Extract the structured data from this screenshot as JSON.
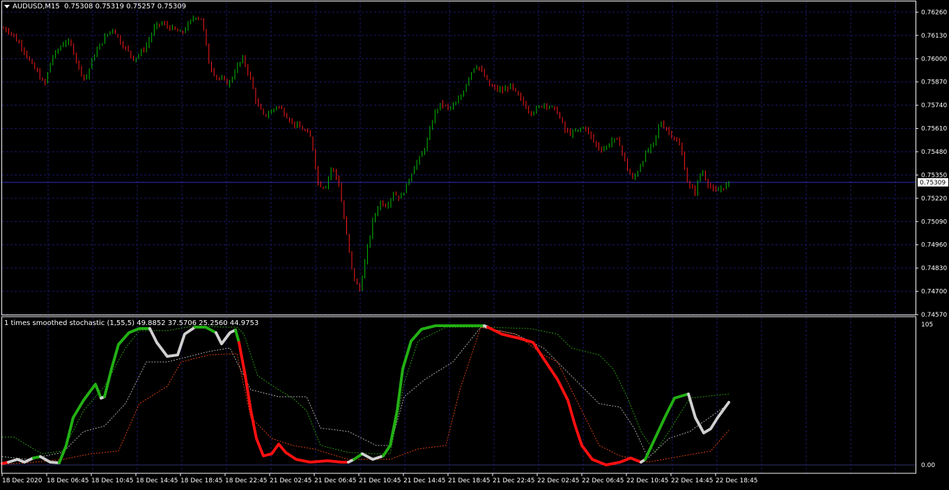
{
  "price_header": {
    "symbol": "AUDUSD,M15",
    "ohlc": "0.75308 0.75319 0.75257 0.75309"
  },
  "osc_header": {
    "text": "1 times smoothed stochastic (1,55,5) 49.8852 37.5706 25.2560 44.9753"
  },
  "colors": {
    "background": "#000000",
    "grid": "#1a1a6e",
    "bull_candle": "#00c000",
    "bear_candle": "#ff1a1a",
    "osc_up": "#22b014",
    "osc_down": "#ff1010",
    "osc_neutral": "#d0d0d0",
    "band_upper": "#2a9a10",
    "band_mid": "#b0b0b0",
    "band_lower": "#e04010",
    "current_price_line": "#3030c0"
  },
  "chart_data": [
    {
      "type": "candlestick",
      "title": "AUDUSD,M15",
      "current_price": "0.75309",
      "ylim": [
        0.7457,
        0.7632
      ],
      "y_ticks": [
        "0.76260",
        "0.76130",
        "0.76000",
        "0.75870",
        "0.75740",
        "0.75610",
        "0.75480",
        "0.75350",
        "0.75220",
        "0.75090",
        "0.74960",
        "0.74830",
        "0.74700",
        "0.74570"
      ],
      "x_tick_labels": [
        "18 Dec 2020",
        "18 Dec 06:45",
        "18 Dec 10:45",
        "18 Dec 14:45",
        "18 Dec 18:45",
        "18 Dec 22:45",
        "21 Dec 02:45",
        "21 Dec 06:45",
        "21 Dec 10:45",
        "21 Dec 14:45",
        "21 Dec 18:45",
        "21 Dec 22:45",
        "22 Dec 02:45",
        "22 Dec 06:45",
        "22 Dec 10:45",
        "22 Dec 14:45",
        "22 Dec 18:45"
      ],
      "close_path": [
        0.7617,
        0.7615,
        0.761,
        0.7605,
        0.7597,
        0.7592,
        0.7585,
        0.76,
        0.7605,
        0.761,
        0.7607,
        0.7595,
        0.7588,
        0.76,
        0.7607,
        0.7613,
        0.7617,
        0.761,
        0.7605,
        0.76,
        0.7603,
        0.7608,
        0.7617,
        0.762,
        0.7618,
        0.7616,
        0.7614,
        0.7619,
        0.7624,
        0.7622,
        0.7598,
        0.759,
        0.7588,
        0.7586,
        0.7595,
        0.76,
        0.759,
        0.7575,
        0.7568,
        0.757,
        0.7574,
        0.757,
        0.7565,
        0.7562,
        0.756,
        0.7555,
        0.753,
        0.7528,
        0.754,
        0.753,
        0.7505,
        0.748,
        0.747,
        0.749,
        0.751,
        0.752,
        0.7518,
        0.7525,
        0.7522,
        0.753,
        0.754,
        0.7545,
        0.7555,
        0.757,
        0.7575,
        0.7572,
        0.7574,
        0.758,
        0.759,
        0.7597,
        0.7592,
        0.7585,
        0.7583,
        0.7582,
        0.7585,
        0.758,
        0.7575,
        0.757,
        0.7572,
        0.7575,
        0.7573,
        0.757,
        0.756,
        0.7558,
        0.756,
        0.7562,
        0.7555,
        0.755,
        0.755,
        0.7555,
        0.7553,
        0.754,
        0.7532,
        0.754,
        0.7548,
        0.7552,
        0.7565,
        0.756,
        0.7556,
        0.755,
        0.753,
        0.7525,
        0.7538,
        0.753,
        0.7525,
        0.7528,
        0.753
      ]
    },
    {
      "type": "line",
      "title": "1 times smoothed stochastic (1,55,5)",
      "values_legend": [
        49.8852,
        37.5706,
        25.256,
        44.9753
      ],
      "ylim": [
        0,
        105
      ],
      "y_ticks": [
        "105",
        "0.00"
      ],
      "series": [
        {
          "role": "stochastic",
          "colors_by_direction": true
        },
        {
          "role": "upper-band",
          "style": "dashed"
        },
        {
          "role": "middle-band",
          "style": "dashed"
        },
        {
          "role": "lower-band",
          "style": "dashed"
        }
      ]
    }
  ]
}
